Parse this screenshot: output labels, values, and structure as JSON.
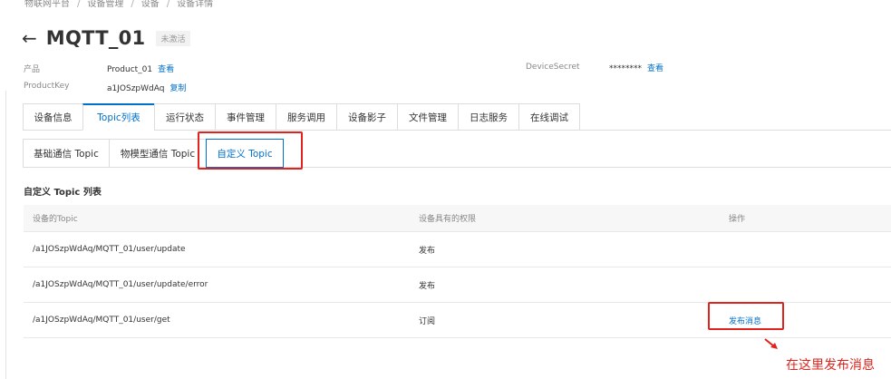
{
  "breadcrumb": [
    "物联网平台",
    "设备管理",
    "设备",
    "设备详情"
  ],
  "device": {
    "title": "MQTT_01",
    "status": "未激活"
  },
  "meta": {
    "product_label": "产品",
    "product_value": "Product_01",
    "product_link": "查看",
    "productkey_label": "ProductKey",
    "productkey_value": "a1JOSzpWdAq",
    "productkey_link": "复制",
    "secret_label": "DeviceSecret",
    "secret_value": "********",
    "secret_link": "查看"
  },
  "tabs": [
    "设备信息",
    "Topic列表",
    "运行状态",
    "事件管理",
    "服务调用",
    "设备影子",
    "文件管理",
    "日志服务",
    "在线调试"
  ],
  "subtabs": [
    "基础通信 Topic",
    "物模型通信 Topic",
    "自定义 Topic"
  ],
  "section_title": "自定义 Topic 列表",
  "table": {
    "headers": [
      "设备的Topic",
      "设备具有的权限",
      "操作"
    ],
    "rows": [
      {
        "topic": "/a1JOSzpWdAq/MQTT_01/user/update",
        "permission": "发布",
        "action": ""
      },
      {
        "topic": "/a1JOSzpWdAq/MQTT_01/user/update/error",
        "permission": "发布",
        "action": ""
      },
      {
        "topic": "/a1JOSzpWdAq/MQTT_01/user/get",
        "permission": "订阅",
        "action": "发布消息"
      }
    ]
  },
  "annotation": "在这里发布消息",
  "colors": {
    "link": "#0070cc",
    "highlight": "#e0231d"
  }
}
